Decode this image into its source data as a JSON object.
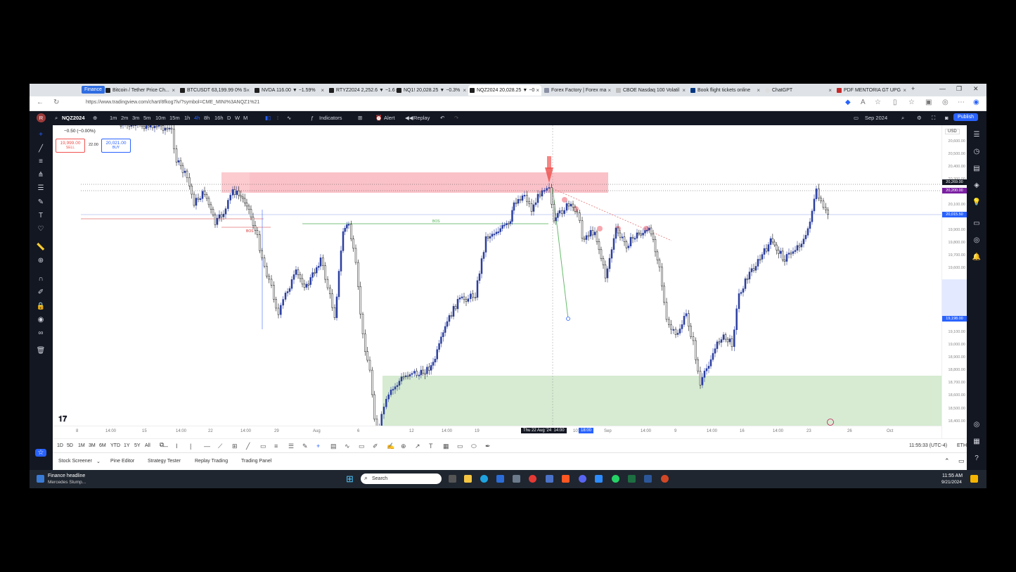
{
  "browser": {
    "finance_badge": "Finance",
    "tabs": [
      {
        "label": "Bitcoin / Tether Price Ch..."
      },
      {
        "label": "BTCUSDT 63,199.99 0% S"
      },
      {
        "label": "NVDA 116.00 ▼ −1.59%"
      },
      {
        "label": "RTYZ2024 2,252.6 ▼ −1.6"
      },
      {
        "label": "NQ1! 20,028.25 ▼ −0.3%"
      },
      {
        "label": "NQZ2024 20,028.25 ▼ −0"
      },
      {
        "label": "Forex Factory | Forex ma"
      },
      {
        "label": "CBOE Nasdaq 100 Volatil"
      },
      {
        "label": "Book flight tickets online"
      },
      {
        "label": "ChatGPT"
      },
      {
        "label": "PDF MENTORIA GT UPG"
      }
    ],
    "url": "https://www.tradingview.com/chart/8fkog7lv/?symbol=CME_MINI%3ANQZ1%21",
    "window_controls": [
      "—",
      "❐",
      "✕"
    ],
    "new_tab": "+"
  },
  "tv_header": {
    "avatar_letter": "R",
    "symbol": "NQZ2024",
    "intervals": [
      "1m",
      "2m",
      "3m",
      "5m",
      "10m",
      "15m",
      "1h",
      "4h",
      "8h",
      "16h",
      "D",
      "W",
      "M"
    ],
    "indicators_label": "Indicators",
    "alert_label": "Alert",
    "replay_label": "Replay",
    "period_label": "Sep 2024",
    "publish_label": "Publish"
  },
  "order_panel": {
    "change": "−0.50 (−0.00%)",
    "sell_price": "19,999.00",
    "sell_label": "SELL",
    "spread": "22.00",
    "buy_price": "20,021.00",
    "buy_label": "BUY"
  },
  "price_axis": {
    "currency": "USD",
    "labels": [
      "20,600.00",
      "20,500.00",
      "20,400.00",
      "20,300.00",
      "20,100.00",
      "19,900.00",
      "19,800.00",
      "19,700.00",
      "19,600.00",
      "19,500.00",
      "19,400.00",
      "19,300.00",
      "19,200.00",
      "19,100.00",
      "19,000.00",
      "18,900.00",
      "18,800.00",
      "18,700.00",
      "18,600.00",
      "18,500.00",
      "18,400.00"
    ],
    "tags": {
      "t1": "20,269.00",
      "t2": "20,200.00",
      "t3": "20,015.50",
      "t4": "19,198.00"
    },
    "tag_colors": {
      "t1": "#131722",
      "t2": "#7b1fa2",
      "t3": "#2962ff",
      "t4": "#2962ff"
    }
  },
  "chart_annotations": {
    "bos1": "BOS",
    "bos2": "BOS"
  },
  "time_axis": {
    "labels": [
      "8",
      "14:00",
      "15",
      "14:00",
      "22",
      "14:00",
      "29",
      "Aug",
      "6",
      "12",
      "14:00",
      "19",
      "10:00",
      "Sep",
      "14:00",
      "9",
      "14:00",
      "16",
      "14:00",
      "23",
      "26",
      "Oct"
    ],
    "crosshair_date": "Thu 22 Aug '24",
    "crosshair_time": "14:00",
    "crosshair_time2": "18:00"
  },
  "range_bar": {
    "ranges": [
      "1D",
      "5D",
      "1M",
      "3M",
      "6M",
      "YTD",
      "1Y",
      "5Y",
      "All"
    ],
    "clock": "11:55:33 (UTC-4)",
    "session": "ETH"
  },
  "bottom_panel": {
    "tabs": [
      "Stock Screener",
      "Pine Editor",
      "Strategy Tester",
      "Replay Trading",
      "Trading Panel"
    ]
  },
  "taskbar": {
    "news_title": "Finance headline",
    "news_sub": "Mercedes Slump...",
    "search_placeholder": "Search",
    "time": "11:55 AM",
    "date": "9/21/2024"
  },
  "colors": {
    "bull": "#2b3fa0",
    "bear": "#111111",
    "supply_zone": "#f7a1ab",
    "demand_zone": "#cfe8c9",
    "accent": "#2962ff"
  }
}
